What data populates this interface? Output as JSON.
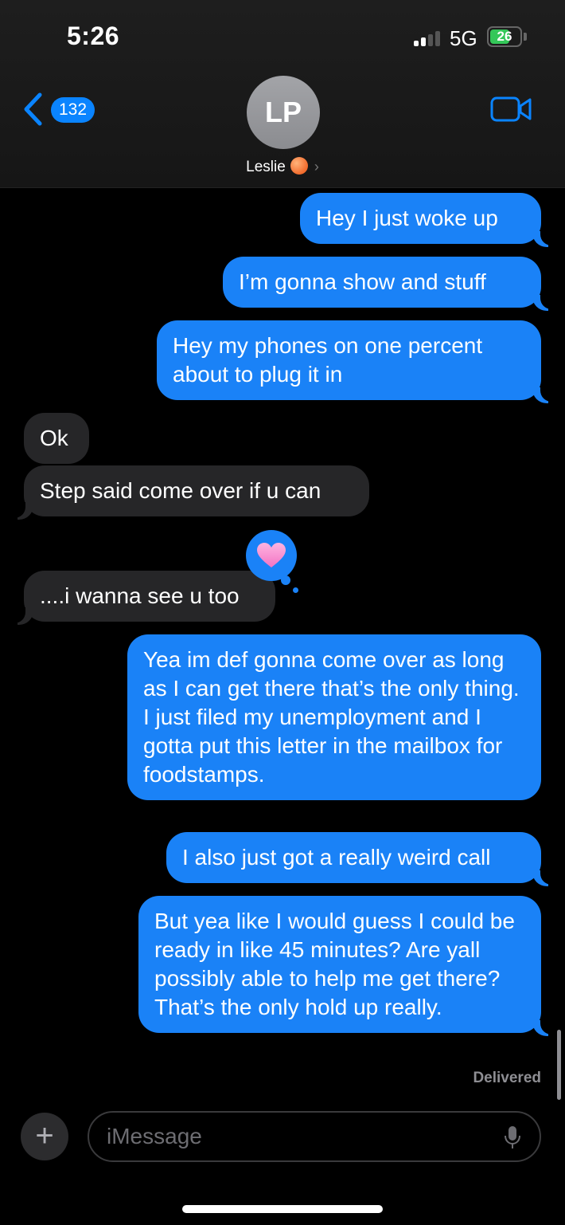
{
  "status_bar": {
    "time": "5:26",
    "network": "5G",
    "battery": "26",
    "battery_level_percent": 26
  },
  "header": {
    "back_count": "132",
    "avatar_initials": "LP",
    "contact_name": "Leslie",
    "contact_emoji": "peach-emoji",
    "chevron": "›"
  },
  "messages": [
    {
      "direction": "sent",
      "text": "Hey I just woke up"
    },
    {
      "direction": "sent",
      "text": "I’m gonna show and stuff"
    },
    {
      "direction": "sent",
      "text": "Hey my phones on one percent about to plug it in"
    },
    {
      "direction": "received",
      "text": "Ok"
    },
    {
      "direction": "received",
      "text": "Step said come over if u can"
    },
    {
      "direction": "received",
      "text": "....i wanna see u too",
      "tapback": "heart"
    },
    {
      "direction": "sent",
      "text": "Yea im def gonna come over as long as I can get there that’s the only thing. I just filed my unemployment and I gotta put this letter in the mailbox for foodstamps."
    },
    {
      "direction": "sent",
      "text": "I also just got a really weird call"
    },
    {
      "direction": "sent",
      "text": "But yea like I would guess I could be ready in like 45 minutes? Are yall possibly able to help me get there? That’s the only hold up really."
    }
  ],
  "delivered_label": "Delivered",
  "compose": {
    "plus": "+",
    "placeholder": "iMessage"
  },
  "colors": {
    "sent_bubble": "#1a82f7",
    "received_bubble": "#262628",
    "battery_green": "#34c759"
  }
}
